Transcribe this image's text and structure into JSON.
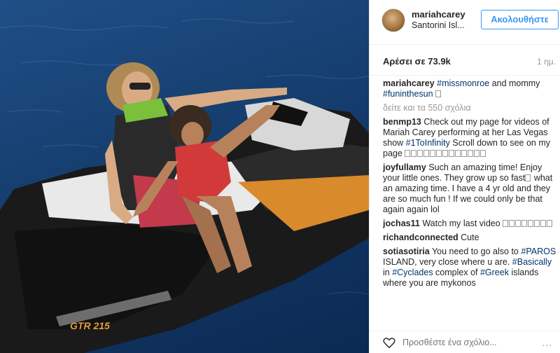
{
  "header": {
    "username": "mariahcarey",
    "location": "Santorini Isl...",
    "follow_label": "Ακολουθήστε"
  },
  "stats": {
    "likes": "Αρέσει σε 73.9k",
    "time_ago": "1 ημ."
  },
  "photo": {
    "jetski_model": "GTR 215"
  },
  "caption": {
    "username": "mariahcarey",
    "tag1": "#missmonroe",
    "text1": " and mommy ",
    "tag2": "#funinthesun"
  },
  "view_comments": "δείτε και τα 550 σχόλια",
  "comments": [
    {
      "user": "benmp13",
      "text1": "Check out my page for videos of Mariah Carey performing at her Las Vegas show ",
      "tag": "#1ToInfinity",
      "text2": " Scroll down to see on my page "
    },
    {
      "user": "joyfullamy",
      "text1": "Such an amazing time! Enjoy your little ones. They grow up so fast",
      "text2": " what an amazing time. I have a 4 yr old and they are so much fun ! If we could only be that again again lol"
    },
    {
      "user": "jochas11",
      "text1": "Watch my last video "
    },
    {
      "user": "richandconnected",
      "text1": "Cute"
    },
    {
      "user": "sotiasotiria",
      "text1": "You need to go also to ",
      "tag": "#PAROS",
      "text2": " ISLAND, very close where u are. ",
      "tag2": "#Basically",
      "text3": " in ",
      "tag3": "#Cyclades",
      "text4": " complex of ",
      "tag4": "#Greek",
      "text5": " islands where you are mykonos"
    }
  ],
  "add_comment_placeholder": "Προσθέστε ένα σχόλιο...",
  "more_options": "...",
  "icons": {
    "heart": "heart-icon",
    "more": "more-options-icon"
  }
}
